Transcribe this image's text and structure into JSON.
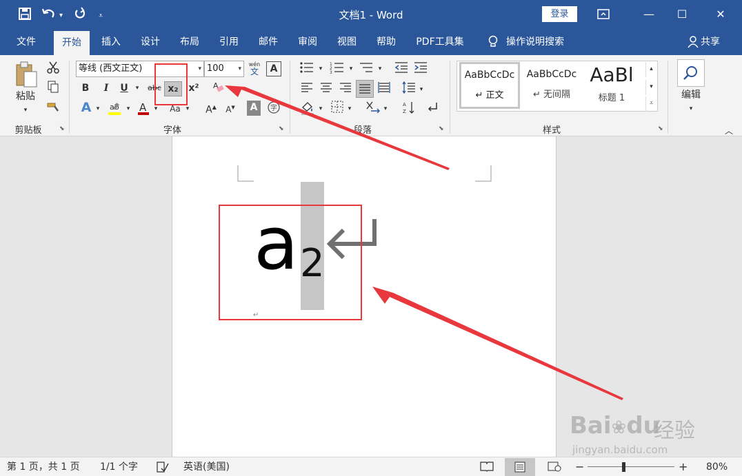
{
  "window": {
    "title": "文档1  -  Word",
    "login_label": "登录"
  },
  "tabs": [
    {
      "label": "文件"
    },
    {
      "label": "开始"
    },
    {
      "label": "插入"
    },
    {
      "label": "设计"
    },
    {
      "label": "布局"
    },
    {
      "label": "引用"
    },
    {
      "label": "邮件"
    },
    {
      "label": "审阅"
    },
    {
      "label": "视图"
    },
    {
      "label": "帮助"
    },
    {
      "label": "PDF工具集"
    }
  ],
  "tell_me": "操作说明搜索",
  "share_label": "共享",
  "clipboard": {
    "paste_label": "粘贴",
    "group_label": "剪贴板"
  },
  "font": {
    "name": "等线 (西文正文)",
    "size": "100",
    "group_label": "字体",
    "bold": "B",
    "italic": "I",
    "underline": "U",
    "strike": "abc",
    "subscript": "x₂",
    "superscript": "x²",
    "phonetic": "wén",
    "charborder": "A"
  },
  "paragraph": {
    "group_label": "段落"
  },
  "styles": {
    "group_label": "样式",
    "items": [
      {
        "preview": "AaBbCcDc",
        "label": "↵ 正文"
      },
      {
        "preview": "AaBbCcDc",
        "label": "↵ 无间隔"
      },
      {
        "preview": "AaBl",
        "label": "标题 1"
      }
    ]
  },
  "editing": {
    "label": "编辑"
  },
  "document": {
    "base_char": "a",
    "subscript_char": "2",
    "para_mark": "↵"
  },
  "status": {
    "page": "第 1 页，共 1 页",
    "words": "1/1 个字",
    "language": "英语(美国)",
    "zoom": "80%"
  },
  "watermark": {
    "brand": "Bai",
    "brand2": "du",
    "cn": "经验",
    "url": "jingyan.baidu.com"
  },
  "colors": {
    "word_blue": "#2b579a",
    "annotation_red": "#e8383d"
  }
}
